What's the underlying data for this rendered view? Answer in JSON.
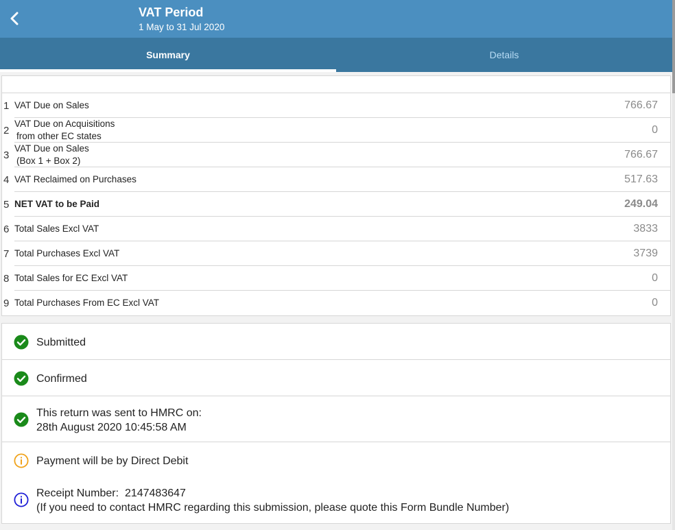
{
  "header": {
    "title": "VAT Period",
    "subtitle": "1 May to 31 Jul 2020"
  },
  "tabs": [
    {
      "label": "Summary",
      "active": true
    },
    {
      "label": "Details",
      "active": false
    }
  ],
  "vat_boxes": [
    {
      "num": "1",
      "label": "VAT Due on Sales",
      "label2": "",
      "value": "766.67",
      "bold": false
    },
    {
      "num": "2",
      "label": "VAT Due on Acquisitions",
      "label2": "from other EC states",
      "value": "0",
      "bold": false
    },
    {
      "num": "3",
      "label": "VAT Due on Sales",
      "label2": "(Box 1 + Box 2)",
      "value": "766.67",
      "bold": false
    },
    {
      "num": "4",
      "label": "VAT Reclaimed on Purchases",
      "label2": "",
      "value": "517.63",
      "bold": false
    },
    {
      "num": "5",
      "label": "NET VAT to be Paid",
      "label2": "",
      "value": "249.04",
      "bold": true
    },
    {
      "num": "6",
      "label": "Total Sales Excl VAT",
      "label2": "",
      "value": "3833",
      "bold": false
    },
    {
      "num": "7",
      "label": "Total Purchases Excl VAT",
      "label2": "",
      "value": "3739",
      "bold": false
    },
    {
      "num": "8",
      "label": "Total Sales for EC Excl VAT",
      "label2": "",
      "value": "0",
      "bold": false
    },
    {
      "num": "9",
      "label": "Total Purchases From EC Excl VAT",
      "label2": "",
      "value": "0",
      "bold": false
    }
  ],
  "status": {
    "submitted": "Submitted",
    "confirmed": "Confirmed",
    "sent_line1": "This return was sent to HMRC on:",
    "sent_line2": "28th August 2020 10:45:58 AM",
    "payment": "Payment will be by Direct Debit",
    "receipt_line1": "Receipt Number:  2147483647",
    "receipt_line2": "(If you need to contact HMRC regarding this submission, please quote this Form Bundle Number)"
  },
  "colors": {
    "header_bg": "#4b8fc0",
    "tabs_bg": "#3a779f",
    "check_green": "#1a8a1a",
    "info_orange": "#f0a21a",
    "info_blue": "#1d1dd6"
  },
  "icons": {
    "back": "chevron-left-icon",
    "success": "check-circle-icon",
    "warning": "info-circle-icon"
  }
}
